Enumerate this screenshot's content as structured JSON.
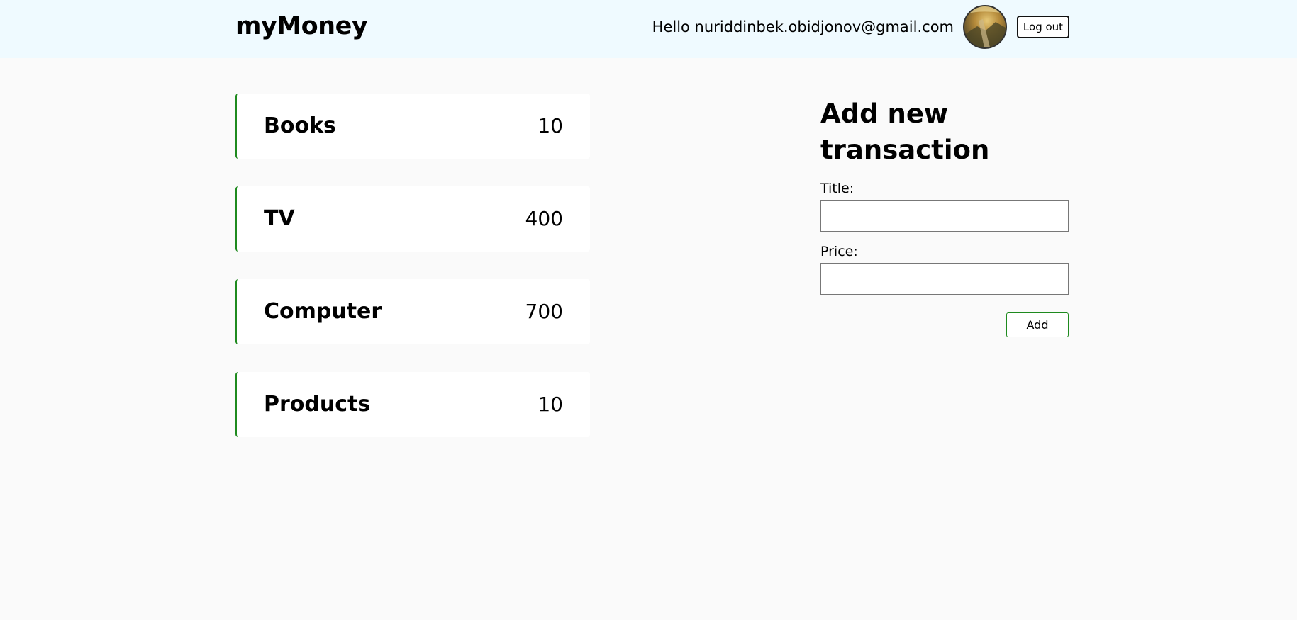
{
  "navbar": {
    "brand": "myMoney",
    "greeting": "Hello nuriddinbek.obidjonov@gmail.com",
    "logout_label": "Log out",
    "bg_color": "#effaff"
  },
  "transactions": [
    {
      "title": "Books",
      "amount": "10"
    },
    {
      "title": "TV",
      "amount": "400"
    },
    {
      "title": "Computer",
      "amount": "700"
    },
    {
      "title": "Products",
      "amount": "10"
    }
  ],
  "form": {
    "heading": "Add new transaction",
    "title_label": "Title:",
    "title_value": "",
    "price_label": "Price:",
    "price_value": "",
    "submit_label": "Add"
  },
  "colors": {
    "accent": "#1e8a1e",
    "page_bg": "#fafafa"
  },
  "icons": {
    "avatar": "user-avatar-photo"
  }
}
